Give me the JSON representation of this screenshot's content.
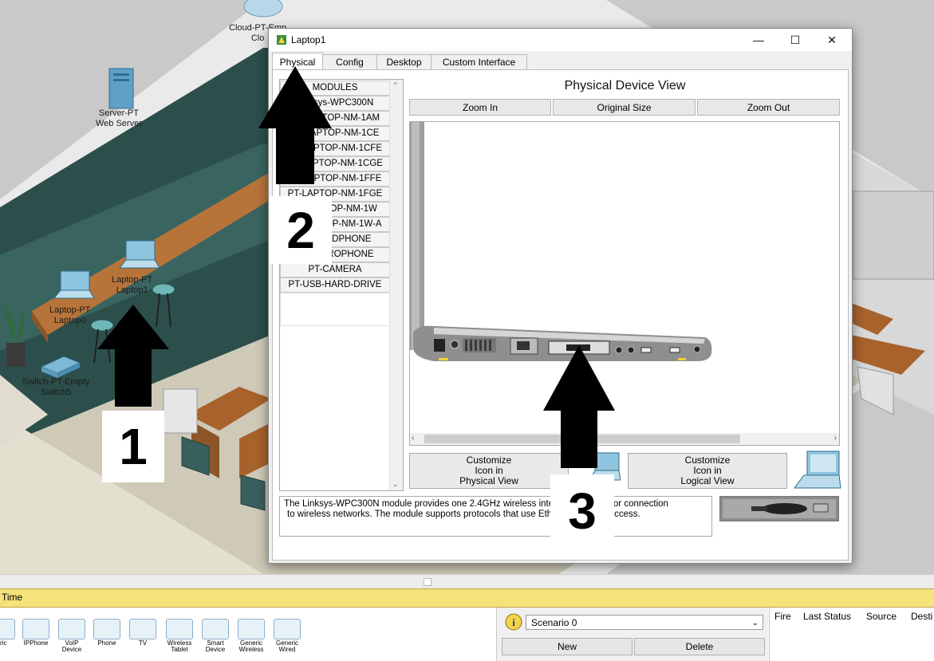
{
  "scene": {
    "devices": [
      {
        "line1": "Cloud-PT-Emp",
        "line2": "Clo"
      },
      {
        "line1": "Server-PT",
        "line2": "Web Server"
      },
      {
        "line1": "Laptop-PT",
        "line2": "Laptop1"
      },
      {
        "line1": "Laptop-PT",
        "line2": "Laptop0"
      },
      {
        "line1": "Switch-PT-Empty",
        "line2": "Switch5"
      }
    ]
  },
  "window": {
    "title": "Laptop1",
    "minimize": "—",
    "maximize": "☐",
    "close": "✕",
    "tabs": [
      {
        "label": "Physical",
        "active": true
      },
      {
        "label": "Config"
      },
      {
        "label": "Desktop"
      },
      {
        "label": "Custom Interface"
      }
    ]
  },
  "modules": [
    "MODULES",
    "Linksys-WPC300N",
    "PT-LAPTOP-NM-1AM",
    "PT-LAPTOP-NM-1CE",
    "PT-LAPTOP-NM-1CFE",
    "PT-LAPTOP-NM-1CGE",
    "PT-LAPTOP-NM-1FFE",
    "PT-LAPTOP-NM-1FGE",
    "PT-LAPTOP-NM-1W",
    "PT-LAPTOP-NM-1W-A",
    "PT-HEADPHONE",
    "PT-MICROPHONE",
    "PT-CAMERA",
    "PT-USB-HARD-DRIVE"
  ],
  "physical": {
    "title": "Physical Device View",
    "zoom_in": "Zoom In",
    "original_size": "Original Size",
    "zoom_out": "Zoom Out",
    "customize_physical": [
      "Customize",
      "Icon in",
      "Physical View"
    ],
    "customize_logical": [
      "Customize",
      "Icon in",
      "Logical View"
    ]
  },
  "description": {
    "line1": "The Linksys-WPC300N module provides one 2.4GHz wireless interface suitable for connection",
    "line2": "to wireless networks. The module supports protocols that use Ethernet for LAN access."
  },
  "annotations": [
    "1",
    "2",
    "3"
  ],
  "bottom": {
    "timebar_label": "Time",
    "device_icons": [
      "eric",
      "IPPhone",
      "VoIP Device",
      "Phone",
      "TV",
      "Wireless Tablet",
      "Smart Device",
      "Generic Wireless",
      "Generic Wired"
    ],
    "scenario": {
      "selected": "Scenario 0",
      "new_label": "New",
      "delete_label": "Delete"
    },
    "event_headers": [
      "Fire",
      "Last Status",
      "Source",
      "Desti"
    ]
  }
}
